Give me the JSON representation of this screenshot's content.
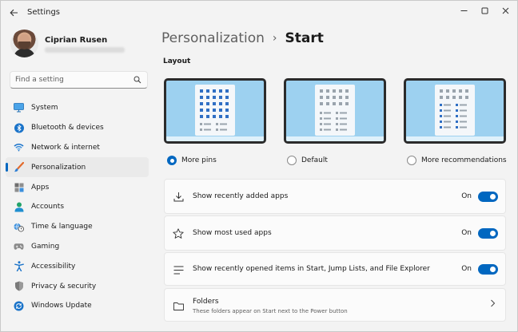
{
  "window": {
    "title": "Settings",
    "controls": [
      "minimize",
      "maximize",
      "close"
    ]
  },
  "profile": {
    "name": "Ciprian Rusen"
  },
  "search": {
    "placeholder": "Find a setting"
  },
  "sidebar": {
    "items": [
      {
        "label": "System",
        "icon": "monitor-icon",
        "active": false
      },
      {
        "label": "Bluetooth & devices",
        "icon": "bluetooth-icon",
        "active": false
      },
      {
        "label": "Network & internet",
        "icon": "wifi-icon",
        "active": false
      },
      {
        "label": "Personalization",
        "icon": "paintbrush-icon",
        "active": true
      },
      {
        "label": "Apps",
        "icon": "apps-icon",
        "active": false
      },
      {
        "label": "Accounts",
        "icon": "person-icon",
        "active": false
      },
      {
        "label": "Time & language",
        "icon": "clock-globe-icon",
        "active": false
      },
      {
        "label": "Gaming",
        "icon": "gamepad-icon",
        "active": false
      },
      {
        "label": "Accessibility",
        "icon": "accessibility-icon",
        "active": false
      },
      {
        "label": "Privacy & security",
        "icon": "shield-icon",
        "active": false
      },
      {
        "label": "Windows Update",
        "icon": "update-icon",
        "active": false
      }
    ]
  },
  "breadcrumb": {
    "parent": "Personalization",
    "separator": "›",
    "current": "Start"
  },
  "layout": {
    "title": "Layout",
    "options": [
      {
        "label": "More pins",
        "selected": true
      },
      {
        "label": "Default",
        "selected": false
      },
      {
        "label": "More recommendations",
        "selected": false
      }
    ]
  },
  "settings": [
    {
      "label": "Show recently added apps",
      "state": "On",
      "icon": "download-icon"
    },
    {
      "label": "Show most used apps",
      "state": "On",
      "icon": "star-icon"
    },
    {
      "label": "Show recently opened items in Start, Jump Lists, and File Explorer",
      "state": "On",
      "icon": "list-icon"
    }
  ],
  "folders": {
    "label": "Folders",
    "description": "These folders appear on Start next to the Power button",
    "icon": "folder-icon"
  },
  "colors": {
    "accent": "#0067c0",
    "thumb_sky": "#9dd1f0",
    "thumb_frame": "#2b2b2b"
  }
}
